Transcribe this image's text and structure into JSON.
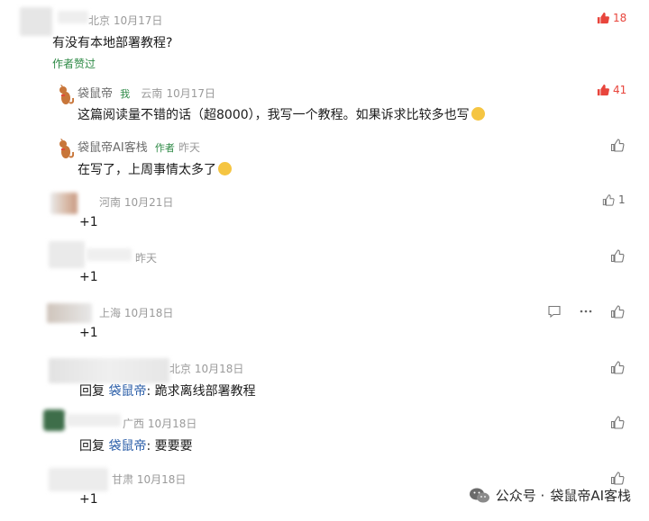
{
  "comments": [
    {
      "meta": "北京 10月17日",
      "text": "有没有本地部署教程?",
      "badge": "作者赞过",
      "likes": "18",
      "replies": [
        {
          "name": "袋鼠帝",
          "tag": "我",
          "region": "云南",
          "date": "10月17日",
          "text": "这篇阅读量不错的话（超8000），我写一个教程。如果诉求比较多也写",
          "likes": "41"
        },
        {
          "name": "袋鼠帝AI客栈",
          "tag": "作者",
          "date": "昨天",
          "text": "在写了，上周事情太多了"
        }
      ]
    },
    {
      "meta": "河南 10月21日",
      "text": "+1",
      "likes": "1"
    },
    {
      "meta": "昨天",
      "text": "+1"
    },
    {
      "meta": "上海 10月18日",
      "text": "+1"
    },
    {
      "meta": "北京 10月18日",
      "reply_prefix": "回复",
      "reply_to": "袋鼠帝",
      "text": ": 跪求离线部署教程"
    },
    {
      "meta": "广西 10月18日",
      "reply_prefix": "回复",
      "reply_to": "袋鼠帝",
      "text": ": 要要要"
    },
    {
      "meta": "甘肃 10月18日",
      "text": "+1"
    }
  ],
  "watermark": {
    "prefix": "公众号 ·",
    "name": "袋鼠帝AI客栈"
  },
  "colors": {
    "like_red": "#e8453c",
    "badge_green": "#2e8a46",
    "meta_gray": "#9a9a9a"
  }
}
